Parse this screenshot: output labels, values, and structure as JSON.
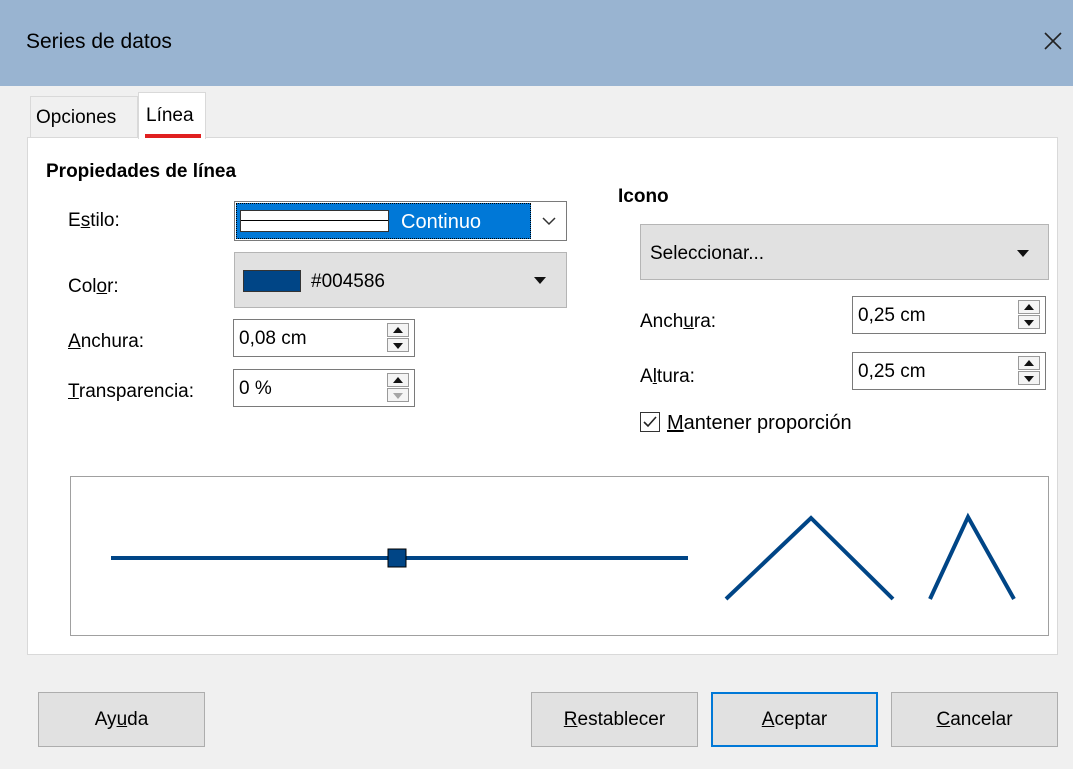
{
  "window": {
    "title": "Series de datos"
  },
  "tabs": [
    {
      "label": "Opciones",
      "active": false
    },
    {
      "label": "Línea",
      "active": true
    }
  ],
  "line_properties": {
    "heading": "Propiedades de línea",
    "style_label": "Estilo:",
    "style_value": "Continuo",
    "color_label": "Color:",
    "color_value": "#004586",
    "color_swatch": "#004586",
    "width_label": "Anchura:",
    "width_value": "0,08 cm",
    "transparency_label": "Transparencia:",
    "transparency_value": "0 %"
  },
  "icon": {
    "heading": "Icono",
    "select_value": "Seleccionar...",
    "width_label": "Anchura:",
    "width_value": "0,25 cm",
    "height_label": "Altura:",
    "height_value": "0,25 cm",
    "keep_ratio_label": "Mantener proporción",
    "keep_ratio_checked": true
  },
  "preview": {
    "line_color": "#004586"
  },
  "buttons": {
    "help": "Ayuda",
    "reset": "Restablecer",
    "ok": "Aceptar",
    "cancel": "Cancelar"
  },
  "colors": {
    "accent": "#0078d7",
    "titlebar": "#99b4d1",
    "tab_indicator": "#e02020"
  }
}
